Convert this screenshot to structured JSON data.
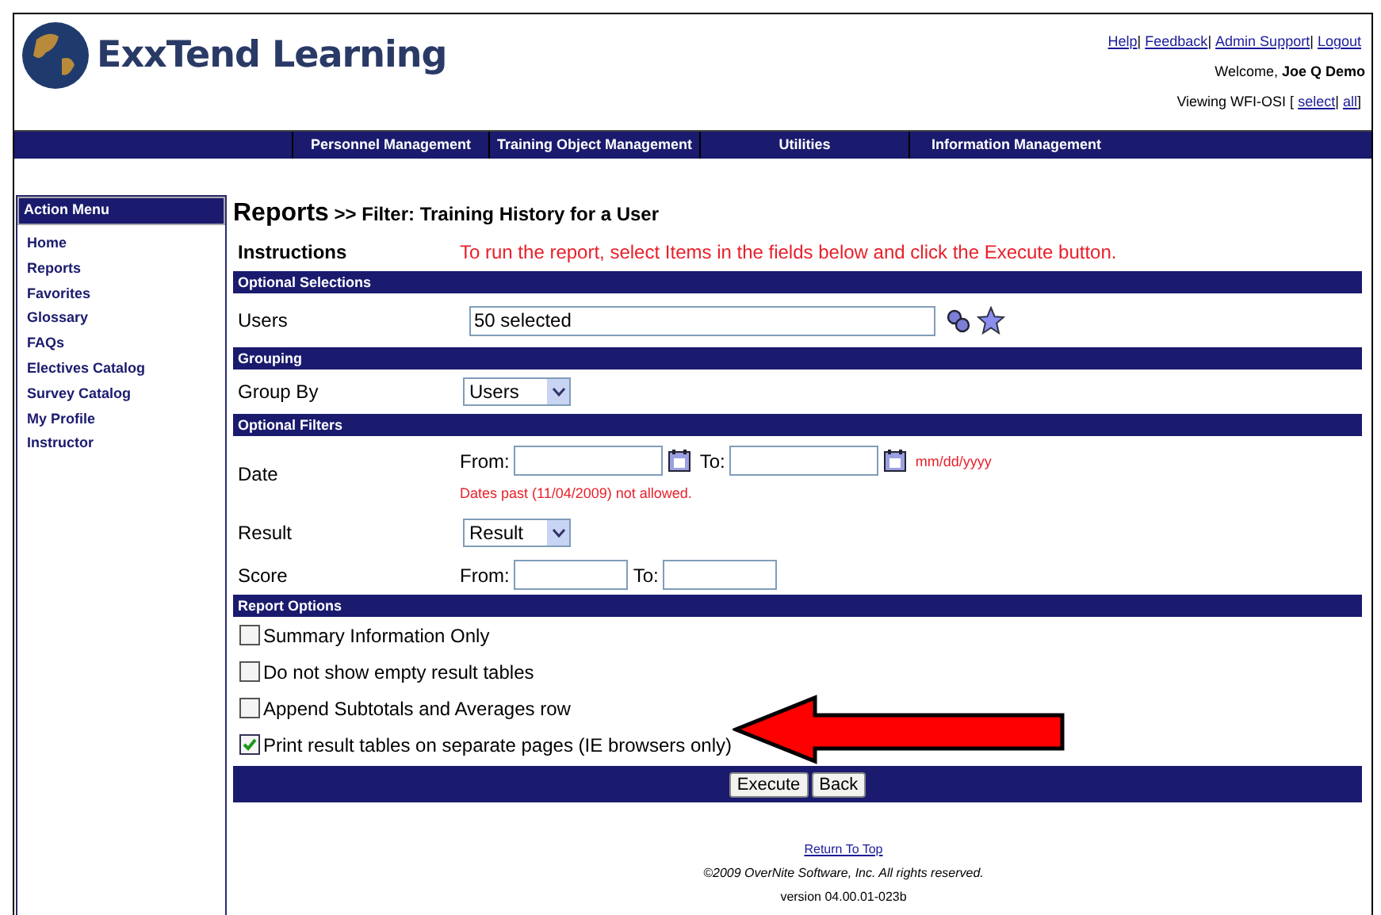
{
  "header": {
    "logo": "ExxTend Learning",
    "links": [
      {
        "label": "Help",
        "after": "|"
      },
      {
        "label": "Feedback",
        "after": "|"
      },
      {
        "label": "Admin Support",
        "after": "|"
      },
      {
        "label": "Logout"
      }
    ],
    "welcome": "Welcome,",
    "user": "Joe Q Demo",
    "viewing": "Viewing WFI-OSI [",
    "view_links": [
      {
        "label": "select",
        "after": "|"
      },
      {
        "label": "all",
        "after": "]"
      }
    ]
  },
  "nav": [
    "Personnel Management",
    "Training Object Management",
    "Utilities",
    "Information Management"
  ],
  "sidebar": {
    "title": "Action Menu",
    "items": [
      "Home",
      "Reports",
      "Favorites",
      "Glossary",
      "FAQs",
      "Electives Catalog",
      "Survey Catalog",
      "My Profile",
      "Instructor"
    ]
  },
  "main": {
    "title": "Reports",
    "subtitle": ">> Filter: Training History for a User",
    "instructions_label": "Instructions",
    "instructions": "To run the report, select Items in the fields below and click the Execute button.",
    "sections": [
      {
        "title": "Optional Selections",
        "rows": [
          {
            "kind": "picker",
            "label": "Users",
            "value": "50 selected"
          }
        ]
      },
      {
        "title": "Grouping",
        "rows": [
          {
            "kind": "select",
            "label": "Group By",
            "value": "Users"
          }
        ]
      },
      {
        "title": "Optional Filters",
        "rows": [
          {
            "kind": "date",
            "label": "Date",
            "from": "From:",
            "to": "To:",
            "format": "mm/dd/yyyy",
            "note": "Dates past (11/04/2009) not allowed."
          },
          {
            "kind": "select",
            "label": "Result",
            "value": "Result"
          },
          {
            "kind": "range",
            "label": "Score",
            "from": "From:",
            "to": "To:"
          }
        ]
      },
      {
        "title": "Report Options",
        "rows": [
          {
            "kind": "check",
            "label": "Summary Information Only",
            "checked": false
          },
          {
            "kind": "check",
            "label": "Do not show empty result tables",
            "checked": false
          },
          {
            "kind": "check",
            "label": "Append Subtotals and Averages row",
            "checked": false
          },
          {
            "kind": "check",
            "label": "Print result tables on separate pages (IE browsers only)",
            "checked": true
          }
        ]
      }
    ],
    "buttons": [
      "Execute",
      "Back"
    ]
  },
  "footer": {
    "link": "Return To Top",
    "copyright": "©2009 OverNite Software, Inc. All rights reserved.",
    "version": "version 04.00.01-023b"
  }
}
